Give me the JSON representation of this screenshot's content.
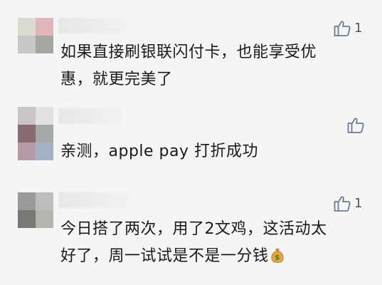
{
  "comments": [
    {
      "avatar_colors": [
        "#d8dccf",
        "#dfb5b8",
        "#c8c7c9",
        "#a4a7a0"
      ],
      "like_count": "1",
      "text_lines": [
        "如果直接刷银联闪付卡，也能享受优",
        "惠，就更完美了"
      ]
    },
    {
      "avatar_colors": [
        "#c9c5c7",
        "#e2e2e2",
        "#8b6b72",
        "#a5aaa8"
      ],
      "like_count": "",
      "text_lines": [
        "亲测，apple pay 打折成功"
      ]
    },
    {
      "avatar_colors": [
        "#9a9a9a",
        "#bdbdbd",
        "#7a7874",
        "#b2b4b0"
      ],
      "like_count": "1",
      "text_lines": [
        "今日搭了两次，用了2文鸡，这活动太",
        "好了，周一试试是不是一分钱"
      ],
      "trailing_emoji": "money-bag-icon"
    }
  ]
}
